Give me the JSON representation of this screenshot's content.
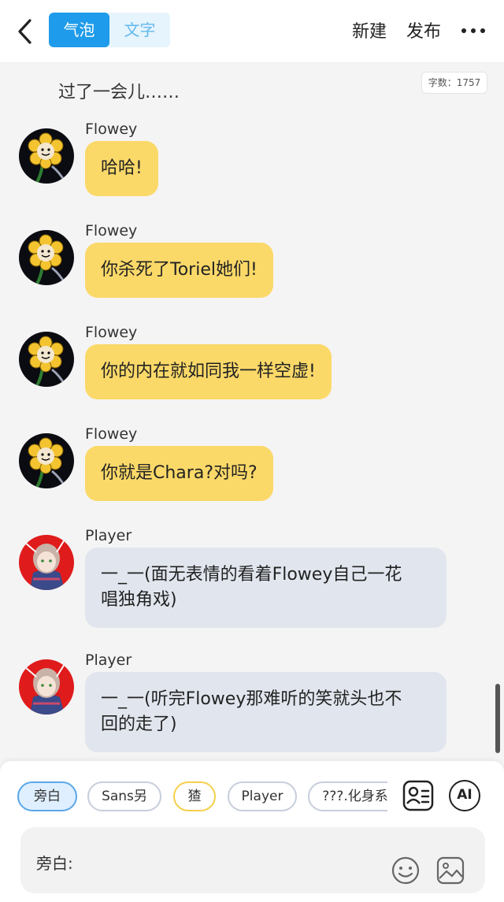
{
  "header": {
    "tabs": [
      {
        "label": "气泡",
        "active": true
      },
      {
        "label": "文字",
        "active": false
      }
    ],
    "new_label": "新建",
    "publish_label": "发布",
    "more_icon": "more-icon"
  },
  "chat": {
    "narration": "过了一会儿……",
    "word_count": "字数：1757",
    "messages": [
      {
        "name": "Flowey",
        "text": "哈哈!",
        "style": "yellow"
      },
      {
        "name": "Flowey",
        "text": "你杀死了Toriel她们!",
        "style": "yellow"
      },
      {
        "name": "Flowey",
        "text": "你的内在就如同我一样空虚!",
        "style": "yellow"
      },
      {
        "name": "Flowey",
        "text": "你就是Chara?对吗?",
        "style": "yellow"
      },
      {
        "name": "Player",
        "text_line1": "一_一(面无表情的看着Flowey自己一花",
        "text_line2": "唱独角戏)",
        "style": "gray"
      },
      {
        "name": "Player",
        "text_line1": "一_一(听完Flowey那难听的笑就头也不",
        "text_line2": "回的走了)",
        "style": "gray"
      }
    ]
  },
  "bottom": {
    "characters": [
      "旁白",
      "Sans另",
      "猹",
      "Player",
      "???.化身系"
    ],
    "selected": "旁白",
    "roster_icon": "character-list-icon",
    "ai_label": "AI",
    "input_label": "旁白:",
    "emoji_icon": "emoji-icon",
    "image_icon": "image-icon"
  },
  "colors": {
    "accent": "#1e9bea",
    "bubble_flowey": "#fbd969",
    "bubble_player": "#e1e6ee"
  }
}
